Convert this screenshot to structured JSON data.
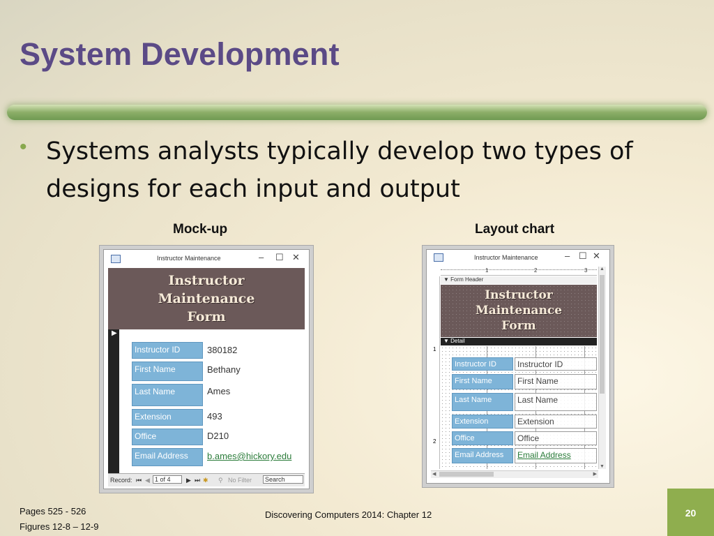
{
  "slide": {
    "title": "System Development",
    "bullet": "Systems analysts typically develop two types of designs for each input and output",
    "footer_pages": "Pages 525 - 526",
    "footer_figures": "Figures 12-8 – 12-9",
    "footer_center": "Discovering Computers 2014: Chapter 12",
    "page_number": "20"
  },
  "mockup": {
    "caption": "Mock-up",
    "window_title": "Instructor Maintenance",
    "banner_lines": [
      "Instructor",
      "Maintenance",
      "Form"
    ],
    "fields": [
      {
        "label": "Instructor ID",
        "value": "380182"
      },
      {
        "label": "First Name",
        "value": "Bethany"
      },
      {
        "label": "Last Name",
        "value": "Ames"
      },
      {
        "label": "Extension",
        "value": "493"
      },
      {
        "label": "Office",
        "value": "D210"
      },
      {
        "label": "Email Address",
        "value": "b.ames@hickory.edu"
      }
    ],
    "nav": {
      "record_label": "Record:",
      "record_value": "1 of 4",
      "no_filter": "No Filter",
      "search": "Search"
    }
  },
  "layout_chart": {
    "caption": "Layout chart",
    "window_title": "Instructor Maintenance",
    "ruler_marks": [
      "1",
      "2",
      "3"
    ],
    "vruler_marks": [
      "1",
      "2"
    ],
    "form_header": "Form Header",
    "detail": "Detail",
    "banner_lines": [
      "Instructor",
      "Maintenance",
      "Form"
    ],
    "fields": [
      {
        "label": "Instructor ID",
        "value": "Instructor ID"
      },
      {
        "label": "First Name",
        "value": "First Name"
      },
      {
        "label": "Last Name",
        "value": "Last Name"
      },
      {
        "label": "Extension",
        "value": "Extension"
      },
      {
        "label": "Office",
        "value": "Office"
      },
      {
        "label": "Email Address",
        "value": "Email Address"
      }
    ]
  },
  "colors": {
    "title": "#5b4a86",
    "accent_green": "#8fae4e",
    "banner": "#6b5959",
    "label_blue": "#7eb4d8",
    "link_green": "#2b7c3a"
  },
  "icons": [
    "form-icon",
    "minimize-icon",
    "maximize-icon",
    "close-icon",
    "record-selector-icon",
    "first-record-icon",
    "prev-record-icon",
    "next-record-icon",
    "last-record-icon",
    "new-record-icon",
    "filter-icon",
    "section-arrow-icon"
  ]
}
